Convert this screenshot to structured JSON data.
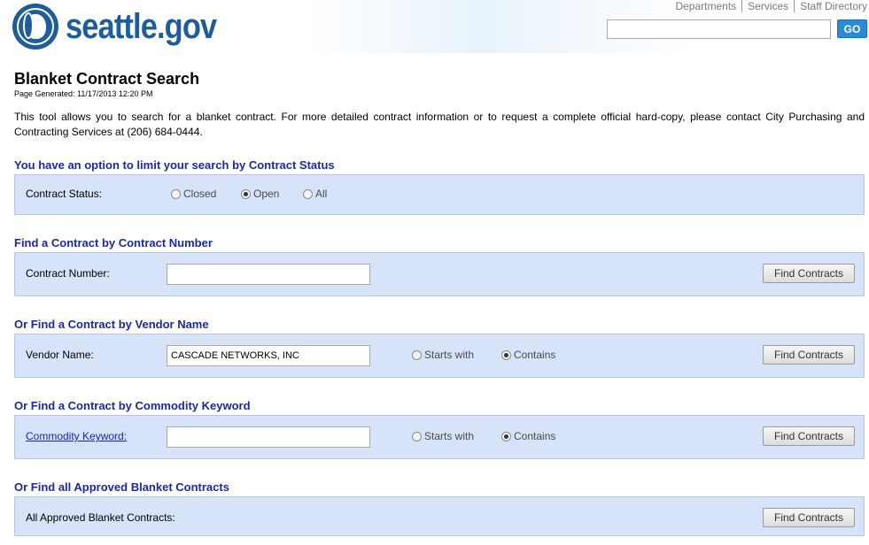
{
  "header": {
    "logo_text": "seattle.gov",
    "links": [
      "Departments",
      "Services",
      "Staff Directory"
    ],
    "search_value": "",
    "go_label": "GO"
  },
  "page": {
    "title": "Blanket Contract Search",
    "generated": "Page Generated: 11/17/2013 12:20 PM",
    "intro": "This tool allows you to search for a blanket contract. For more detailed contract information or to request a complete official hard-copy, please contact City Purchasing and Contracting Services at (206) 684-0444."
  },
  "status_section": {
    "title": "You have an option to limit your search by Contract Status",
    "label": "Contract Status:",
    "options": [
      "Closed",
      "Open",
      "All"
    ],
    "selected": "Open"
  },
  "number_section": {
    "title": "Find a Contract by Contract Number",
    "label": "Contract Number:",
    "value": "",
    "button": "Find Contracts"
  },
  "vendor_section": {
    "title": "Or Find a Contract by Vendor Name",
    "label": "Vendor Name:",
    "value": "CASCADE NETWORKS, INC",
    "options": [
      "Starts with",
      "Contains"
    ],
    "selected": "Contains",
    "button": "Find Contracts"
  },
  "commodity_section": {
    "title": "Or Find a Contract by Commodity Keyword",
    "label": "Commodity Keyword:",
    "value": "",
    "options": [
      "Starts with",
      "Contains"
    ],
    "selected": "Contains",
    "button": "Find Contracts"
  },
  "all_section": {
    "title": "Or Find all Approved Blanket Contracts",
    "label": "All Approved Blanket Contracts:",
    "button": "Find Contracts"
  }
}
